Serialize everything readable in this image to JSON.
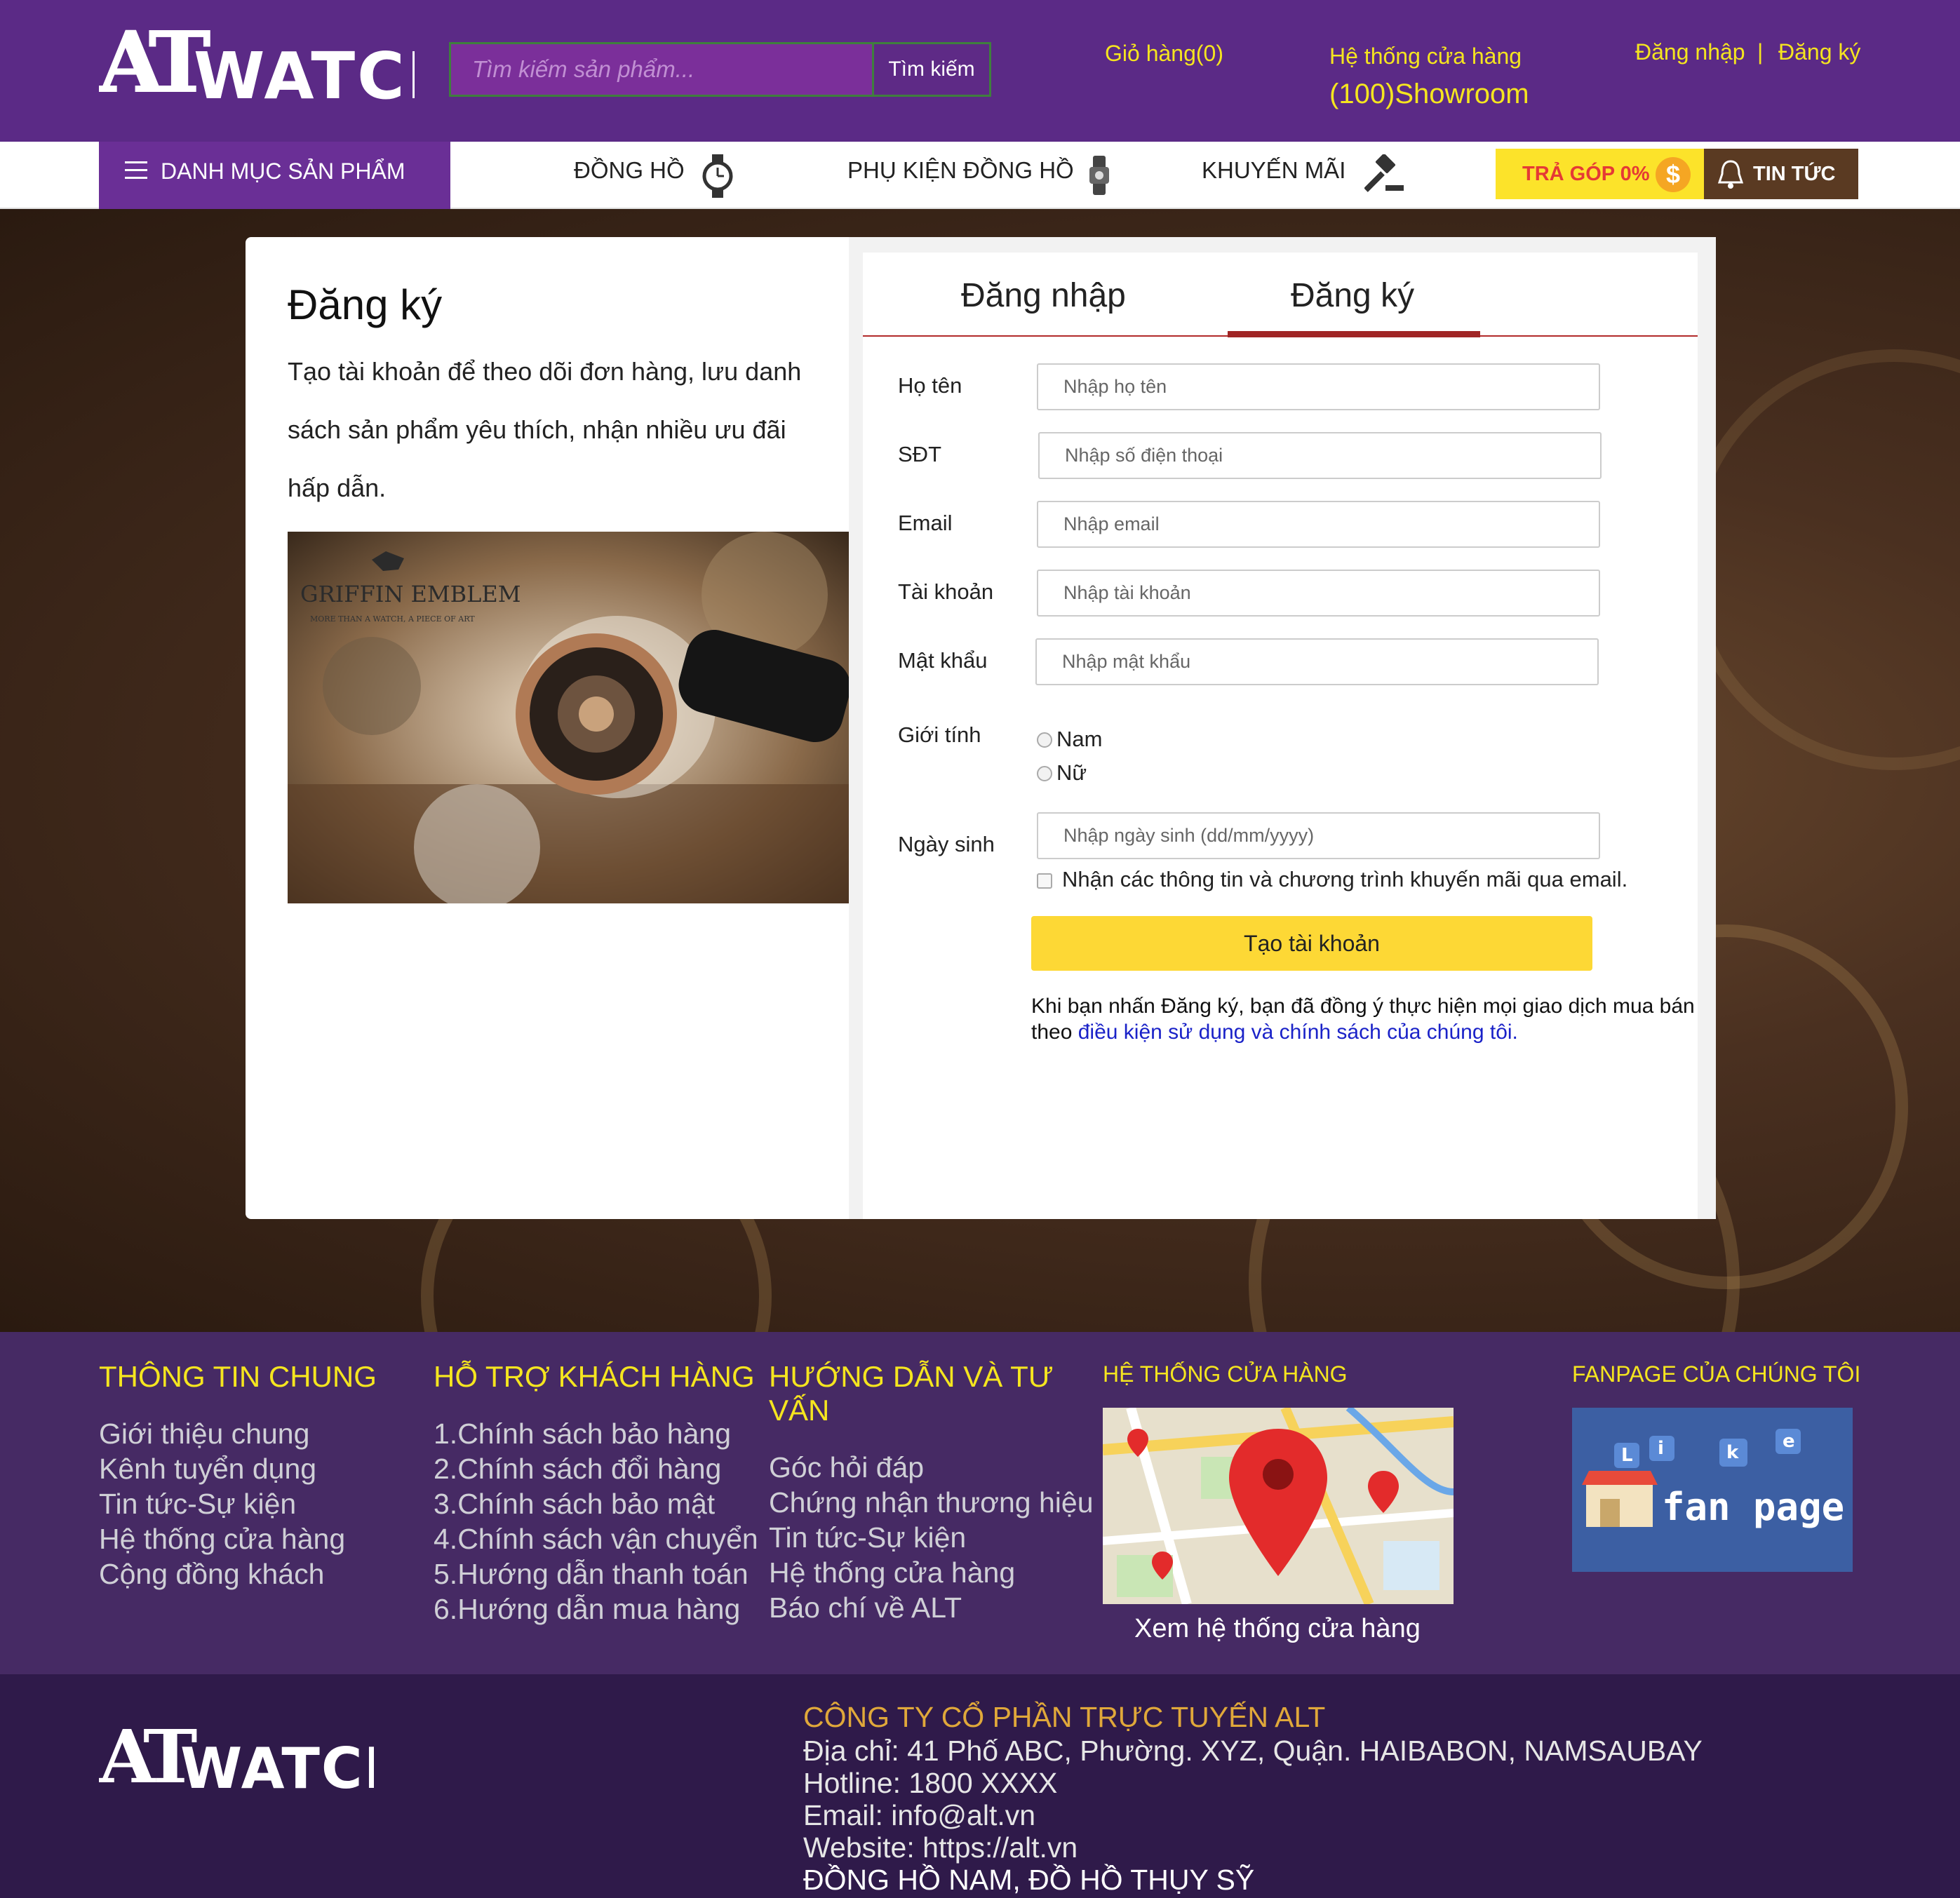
{
  "header": {
    "logo_text": "ALT WATCH",
    "search_placeholder": "Tìm kiếm sản phẩm...",
    "search_button": "Tìm kiếm",
    "cart": "Giỏ hàng(0)",
    "stores": "Hệ thống cửa hàng",
    "showroom": "(100)Showroom",
    "login": "Đăng nhập",
    "separator": "|",
    "register": "Đăng ký"
  },
  "nav": {
    "category_button": "DANH MỤC SẢN PHẨM",
    "items": [
      {
        "label": "ĐỒNG HỒ",
        "icon": "watch-icon"
      },
      {
        "label": "PHỤ KIỆN ĐỒNG HỒ",
        "icon": "watch-strap-icon"
      },
      {
        "label": "KHUYẾN MÃI",
        "icon": "gavel-icon"
      }
    ],
    "installment": "TRẢ GÓP 0%",
    "installment_icon": "dollar-coin-icon",
    "news": "TIN TỨC",
    "news_icon": "bell-icon"
  },
  "register_page": {
    "title": "Đăng ký",
    "description": "Tạo tài khoản để theo dõi đơn hàng, lưu danh sách sản phẩm yêu thích, nhận nhiều ưu đãi hấp dẫn.",
    "promo_brand": "GRIFFIN EMBLEM",
    "promo_tagline": "MORE THAN A WATCH, A PIECE OF ART",
    "tabs": [
      "Đăng nhập",
      "Đăng ký"
    ],
    "active_tab": "Đăng ký",
    "fields": {
      "fullname": {
        "label": "Họ tên",
        "placeholder": "Nhập họ tên"
      },
      "phone": {
        "label": "SĐT",
        "placeholder": "Nhập số điện thoại"
      },
      "email": {
        "label": "Email",
        "placeholder": "Nhập email"
      },
      "account": {
        "label": "Tài khoản",
        "placeholder": "Nhập tài khoản"
      },
      "password": {
        "label": "Mật khẩu",
        "placeholder": "Nhập mật khẩu"
      },
      "gender": {
        "label": "Giới tính",
        "options": [
          "Nam",
          "Nữ"
        ]
      },
      "birthday": {
        "label": "Ngày sinh",
        "placeholder": "Nhập ngày sinh (dd/mm/yyyy)"
      }
    },
    "newsletter": "Nhận các thông tin và chương trình khuyến mãi qua email.",
    "submit": "Tạo tài khoản",
    "terms_prefix": "Khi bạn nhấn Đăng ký, bạn đã đồng ý thực hiện mọi giao dịch mua bán theo ",
    "terms_link": "điều kiện sử dụng và chính sách của chúng tôi."
  },
  "footer": {
    "col1": {
      "title": "THÔNG TIN CHUNG",
      "items": [
        "Giới thiệu chung",
        "Kênh tuyển dụng",
        "Tin tức-Sự kiện",
        "Hệ thống cửa hàng",
        "Cộng đồng khách"
      ]
    },
    "col2": {
      "title": "HỖ TRỢ KHÁCH HÀNG",
      "items": [
        "1.Chính sách bảo hàng",
        "2.Chính sách đổi hàng",
        "3.Chính sách bảo mật",
        "4.Chính sách vận chuyển",
        "5.Hướng dẫn thanh toán",
        "6.Hướng dẫn mua hàng"
      ]
    },
    "col3": {
      "title": "HƯỚNG DẪN VÀ TƯ VẤN",
      "items": [
        "Góc hỏi đáp",
        "Chứng nhận thương hiệu",
        "Tin tức-Sự kiện",
        "Hệ thống cửa hàng",
        "Báo chí về ALT"
      ]
    },
    "col4": {
      "title": "HỆ THỐNG CỬA HÀNG",
      "caption": "Xem hệ thống cửa hàng"
    },
    "col5": {
      "title": "FANPAGE CỦA CHÚNG TÔI",
      "image_text": "fan page",
      "like_text": "Like"
    }
  },
  "bottom": {
    "company": "CÔNG TY CỔ PHẦN TRỰC TUYẾN ALT",
    "address": "Địa chỉ: 41 Phố ABC, Phường. XYZ, Quận. HAIBABON, NAMSAUBAY",
    "hotline": "Hotline: 1800 XXXX",
    "email": "Email: info@alt.vn",
    "website": "Website: https://alt.vn",
    "slogan": "ĐỒNG HỒ NAM, ĐỒ HỒ THỤY SỸ"
  },
  "colors": {
    "header_bg": "#5b2a86",
    "accent_yellow": "#f5e51f",
    "button_yellow": "#fdd835",
    "tab_red": "#a02525",
    "footer_bg": "#462a64",
    "bottom_bg": "#2f1a4a"
  }
}
